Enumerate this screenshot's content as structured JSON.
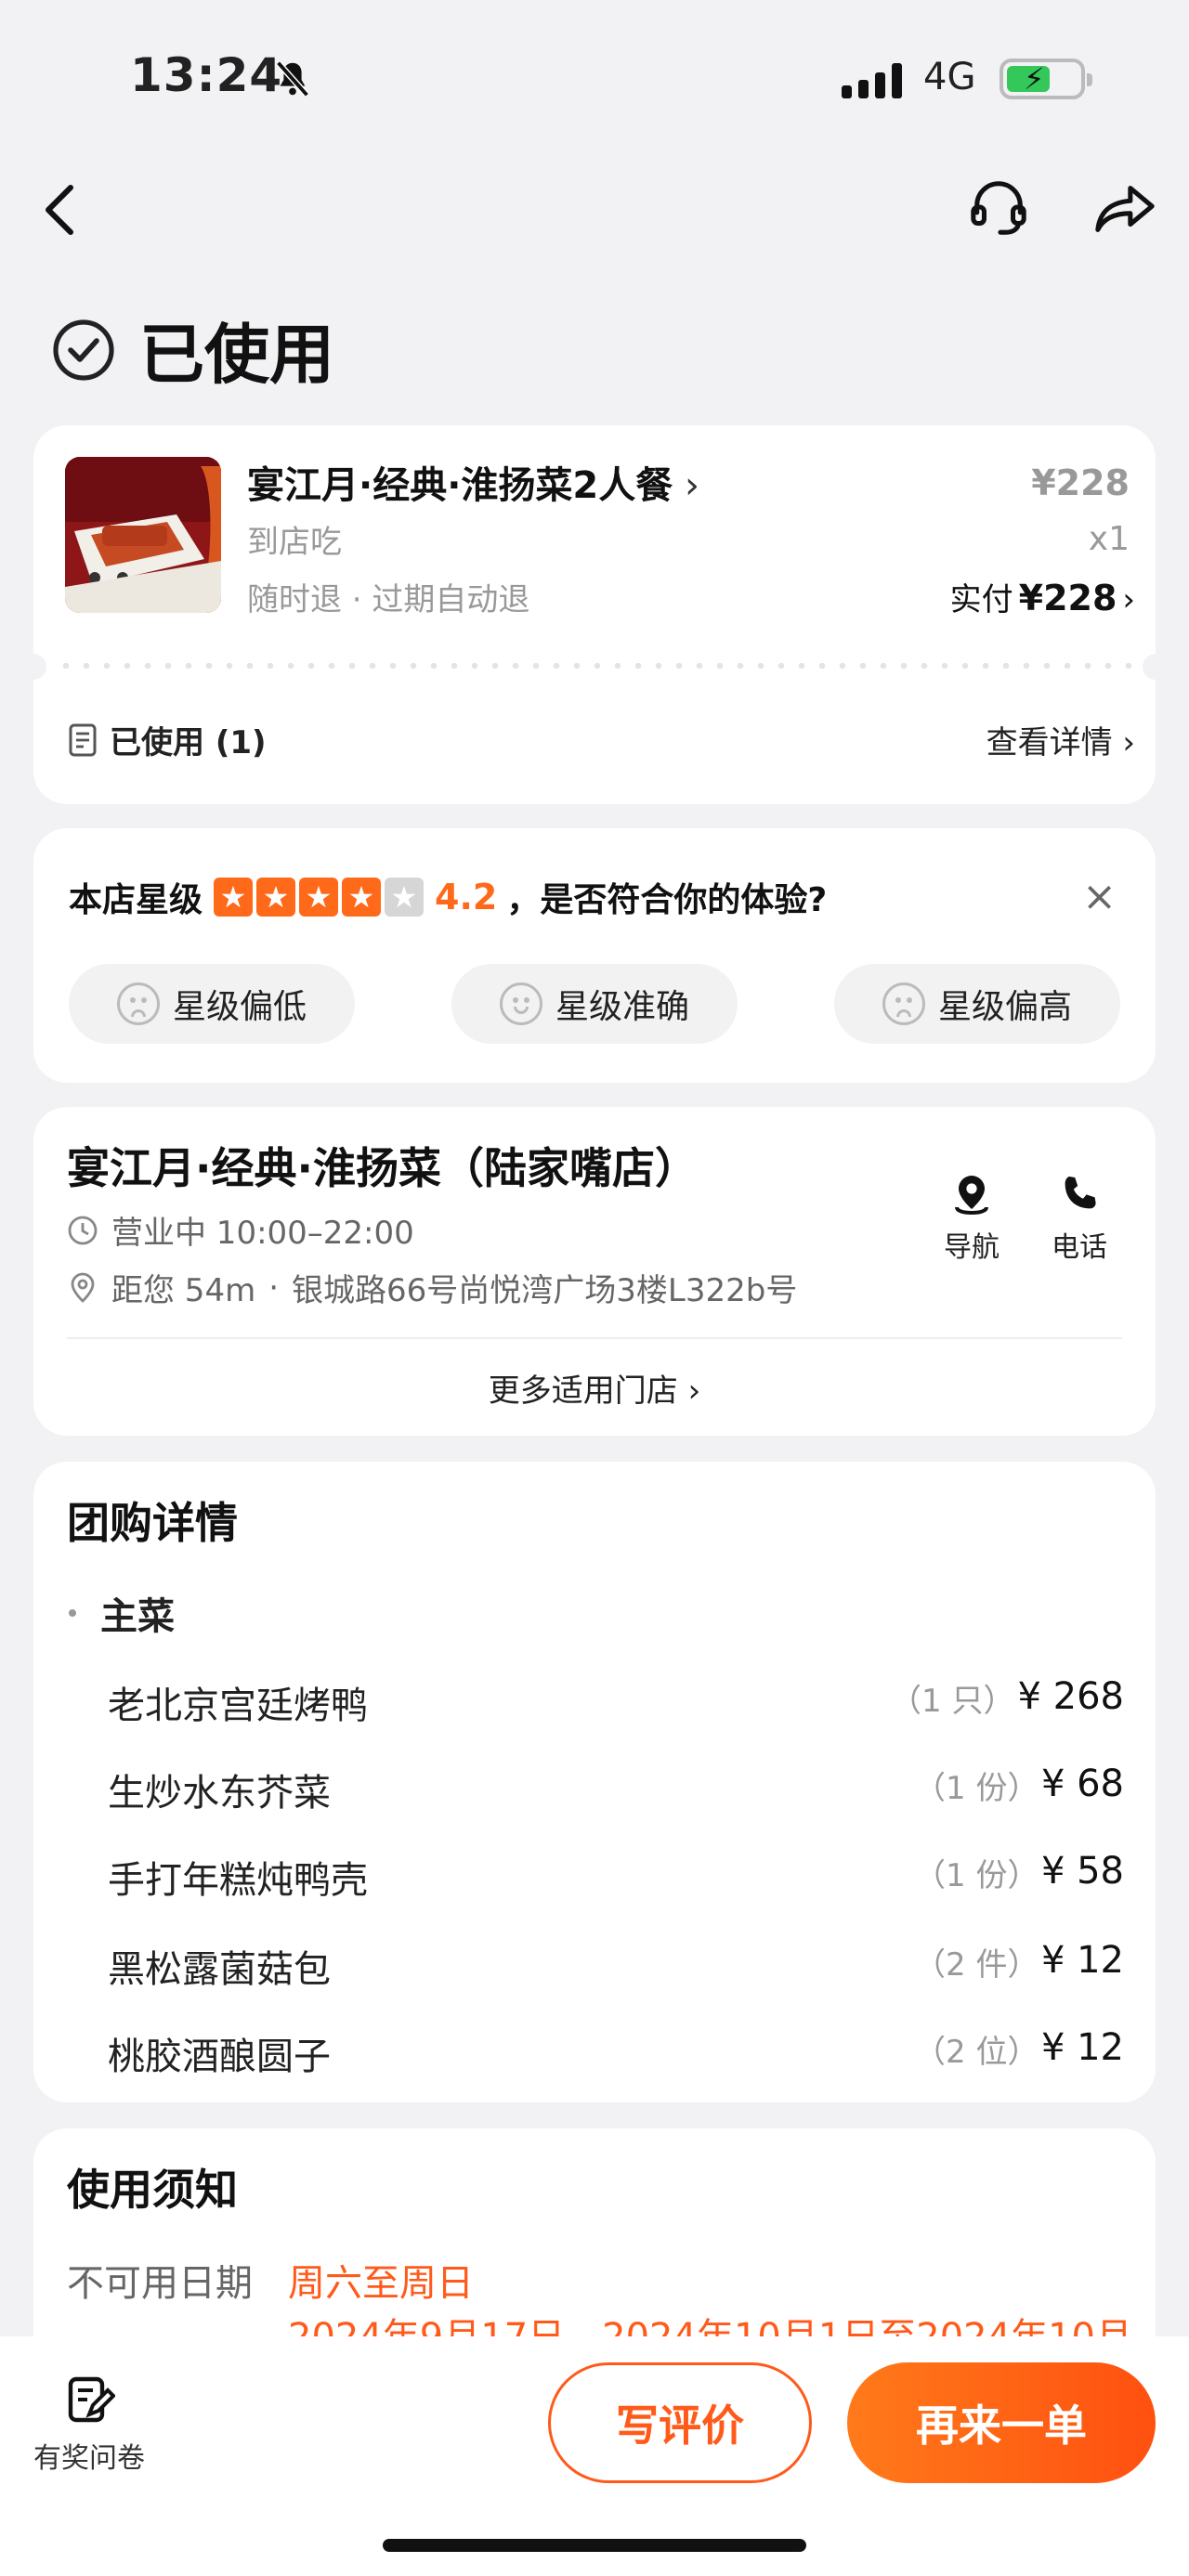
{
  "status_bar": {
    "time": "13:24",
    "network": "4G"
  },
  "page": {
    "status": "已使用"
  },
  "order": {
    "name": "宴江月·经典·淮扬菜2人餐",
    "type": "到店吃",
    "policy": "随时退 · 过期自动退",
    "price": "¥228",
    "quantity": "x1",
    "paid_label": "实付",
    "paid_amount": "¥228",
    "used_label": "已使用 (1)",
    "detail_link": "查看详情"
  },
  "rating": {
    "label": "本店星级",
    "score": "4.2",
    "stars_filled": 4,
    "question": "，是否符合你的体验?",
    "options": [
      "星级偏低",
      "星级准确",
      "星级偏高"
    ]
  },
  "shop": {
    "name": "宴江月·经典·淮扬菜（陆家嘴店）",
    "hours": "营业中 10:00–22:00",
    "distance": "距您 54m",
    "address": "银城路66号尚悦湾广场3楼L322b号",
    "nav_label": "导航",
    "phone_label": "电话",
    "more_stores": "更多适用门店"
  },
  "package": {
    "title": "团购详情",
    "category": "主菜",
    "items": [
      {
        "name": "老北京宫廷烤鸭",
        "qty": "（1 只）",
        "price": "¥ 268"
      },
      {
        "name": "生炒水东芥菜",
        "qty": "（1 份）",
        "price": "¥ 68"
      },
      {
        "name": "手打年糕炖鸭壳",
        "qty": "（1 份）",
        "price": "¥ 58"
      },
      {
        "name": "黑松露菌菇包",
        "qty": "（2 件）",
        "price": "¥ 12"
      },
      {
        "name": "桃胶酒酿圆子",
        "qty": "（2 位）",
        "price": "¥ 12"
      }
    ]
  },
  "notice": {
    "title": "使用须知",
    "unavailable_label": "不可用日期",
    "unavailable_value": "周六至周日",
    "unavailable_value2": "2024年9月17日、2024年10月1日至2024年10月"
  },
  "bottom": {
    "survey_label": "有奖问卷",
    "review_button": "写评价",
    "reorder_button": "再来一单"
  }
}
